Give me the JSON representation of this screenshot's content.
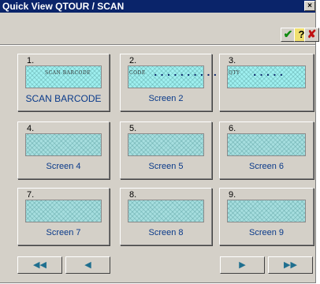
{
  "window": {
    "title": "Quick View QTOUR / SCAN",
    "close_label": "×"
  },
  "toolbar": {
    "ok_label": "✔",
    "help_label": "?",
    "cancel_label": "✘"
  },
  "panels": [
    {
      "number": "1.",
      "label": "SCAN BARCODE",
      "thumb_text": "SCAN BARCODE",
      "dots": ""
    },
    {
      "number": "2.",
      "label": "Screen 2",
      "thumb_text": "CODE",
      "dots": "............."
    },
    {
      "number": "3.",
      "label": "",
      "thumb_text": "QTY",
      "dots": "....."
    },
    {
      "number": "4.",
      "label": "Screen 4",
      "thumb_text": "",
      "dots": ""
    },
    {
      "number": "5.",
      "label": "Screen 5",
      "thumb_text": "",
      "dots": ""
    },
    {
      "number": "6.",
      "label": "Screen 6",
      "thumb_text": "",
      "dots": ""
    },
    {
      "number": "7.",
      "label": "Screen 7",
      "thumb_text": "",
      "dots": ""
    },
    {
      "number": "8.",
      "label": "Screen 8",
      "thumb_text": "",
      "dots": ""
    },
    {
      "number": "9.",
      "label": "Screen 9",
      "thumb_text": "",
      "dots": ""
    }
  ],
  "nav": {
    "first_label": "◀◀",
    "prev_label": "◀",
    "next_label": "▶",
    "last_label": "▶▶"
  },
  "colors": {
    "titlebar": "#0a246a",
    "thumb": "#9ff0f0",
    "label": "#0a3a8a",
    "ok": "#108a10",
    "cancel": "#c01010"
  }
}
